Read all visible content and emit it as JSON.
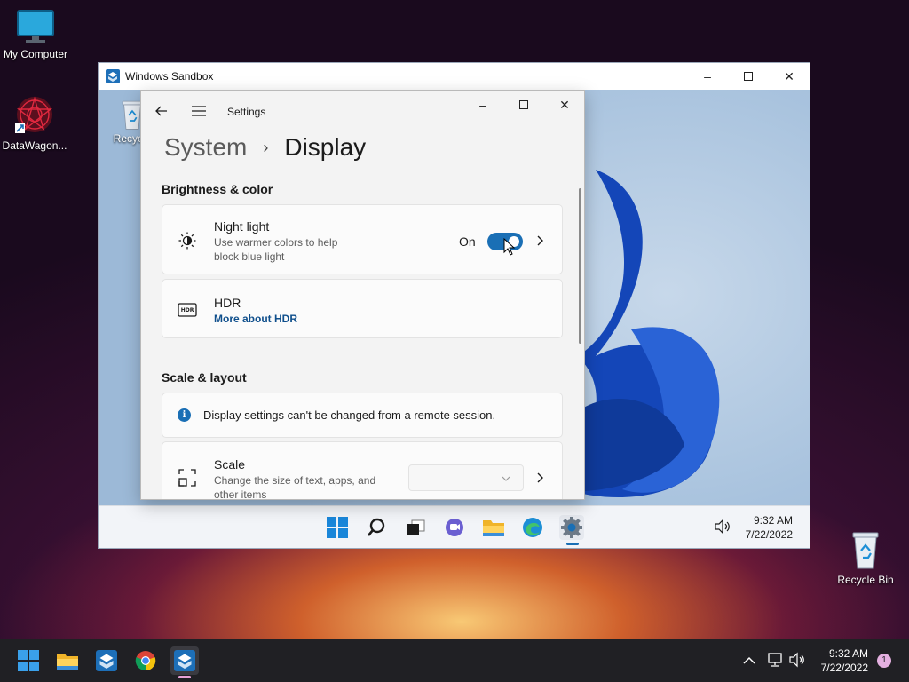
{
  "desktop": {
    "icons": [
      {
        "label": "My Computer"
      },
      {
        "label": "DataWagon..."
      },
      {
        "label": "Recycle Bin"
      }
    ]
  },
  "sandbox": {
    "title": "Windows Sandbox",
    "inner_desktop": {
      "recycle_label": "Recycle"
    },
    "taskbar": {
      "time": "9:32 AM",
      "date": "7/22/2022"
    }
  },
  "settings": {
    "app_title": "Settings",
    "breadcrumb_parent": "System",
    "breadcrumb_sep": "›",
    "page_title": "Display",
    "section_brightness": "Brightness & color",
    "night_light": {
      "title": "Night light",
      "desc_line1": "Use warmer colors to help",
      "desc_line2": "block blue light",
      "state": "On"
    },
    "hdr": {
      "title": "HDR",
      "link": "More about HDR",
      "icon_text": "HDR"
    },
    "section_scale": "Scale & layout",
    "remote_info": "Display settings can't be changed from a remote session.",
    "scale": {
      "title": "Scale",
      "desc_line1": "Change the size of text, apps, and",
      "desc_line2": "other items"
    }
  },
  "host_taskbar": {
    "time": "9:32 AM",
    "date": "7/22/2022",
    "notification_count": "1"
  },
  "colors": {
    "accent": "#1a6fb5",
    "link": "#0f4f8c",
    "taskbar": "#202024"
  }
}
